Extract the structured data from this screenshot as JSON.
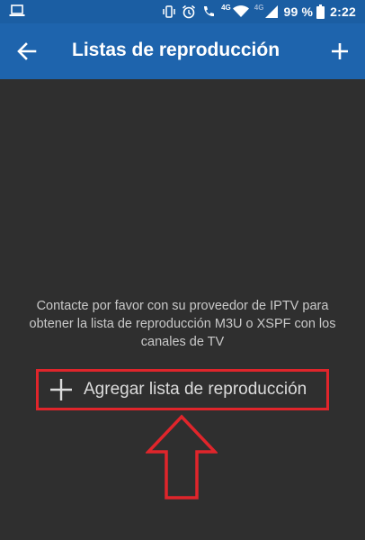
{
  "status_bar": {
    "left_icon": "laptop-icon",
    "icons": [
      "vibrate-icon",
      "alarm-icon",
      "wifi-calling-icon",
      "wifi-icon",
      "signal-icon",
      "battery-icon"
    ],
    "network_label_1": "4G",
    "network_label_2": "4G",
    "battery": "99 %",
    "time": "2:22"
  },
  "app_bar": {
    "title": "Listas de reproducción",
    "back_icon": "arrow-back-icon",
    "add_icon": "plus-icon",
    "color": "#1e64ad"
  },
  "main": {
    "message": "Contacte por favor con su proveedor de IPTV para obtener la lista de reproducción M3U o XSPF con los canales de TV",
    "add_button_label": "Agregar lista de reproducción",
    "add_button_icon": "plus-icon"
  },
  "annotation": {
    "highlight_color": "#e0252b",
    "arrow_icon": "up-arrow-outline-icon"
  }
}
